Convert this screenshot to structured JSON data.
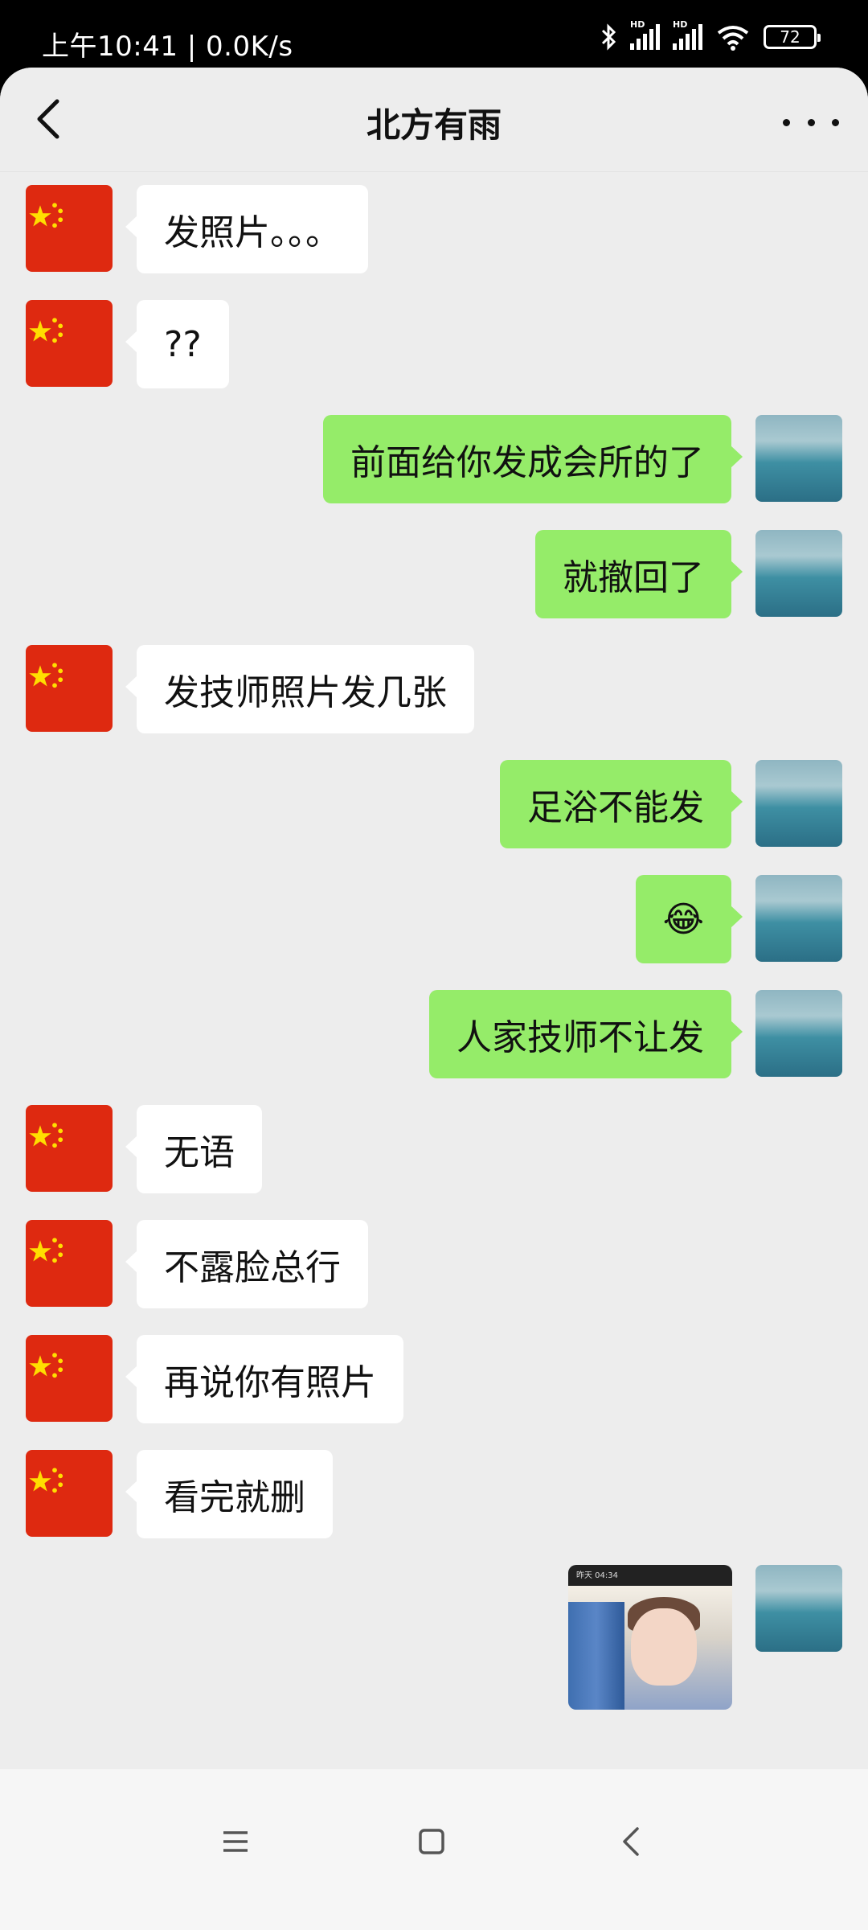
{
  "status_bar": {
    "time_speed": "上午10:41 | 0.0K/s",
    "battery": "72",
    "signal_label": "HD"
  },
  "header": {
    "title": "北方有雨"
  },
  "messages": [
    {
      "side": "left",
      "text": "发照片。。。"
    },
    {
      "side": "left",
      "text": "??"
    },
    {
      "side": "right",
      "text": "前面给你发成会所的了"
    },
    {
      "side": "right",
      "text": "就撤回了"
    },
    {
      "side": "left",
      "text": "发技师照片发几张"
    },
    {
      "side": "right",
      "text": "足浴不能发"
    },
    {
      "side": "right",
      "text": "😂"
    },
    {
      "side": "right",
      "text": "人家技师不让发"
    },
    {
      "side": "left",
      "text": "无语"
    },
    {
      "side": "left",
      "text": "不露脸总行"
    },
    {
      "side": "left",
      "text": "再说你有照片"
    },
    {
      "side": "left",
      "text": "看完就删"
    }
  ],
  "image_message": {
    "top_left": "昨天 04:34"
  },
  "colors": {
    "sent_bubble": "#95ec69",
    "received_bubble": "#ffffff",
    "background": "#ededed"
  },
  "icons": {
    "back": "chevron-left-icon",
    "more": "ellipsis-icon",
    "voice": "voice-icon",
    "emoji": "smiley-icon",
    "plus": "plus-icon",
    "nav_menu": "menu-icon",
    "nav_home": "square-icon",
    "nav_back": "back-triangle-icon"
  }
}
